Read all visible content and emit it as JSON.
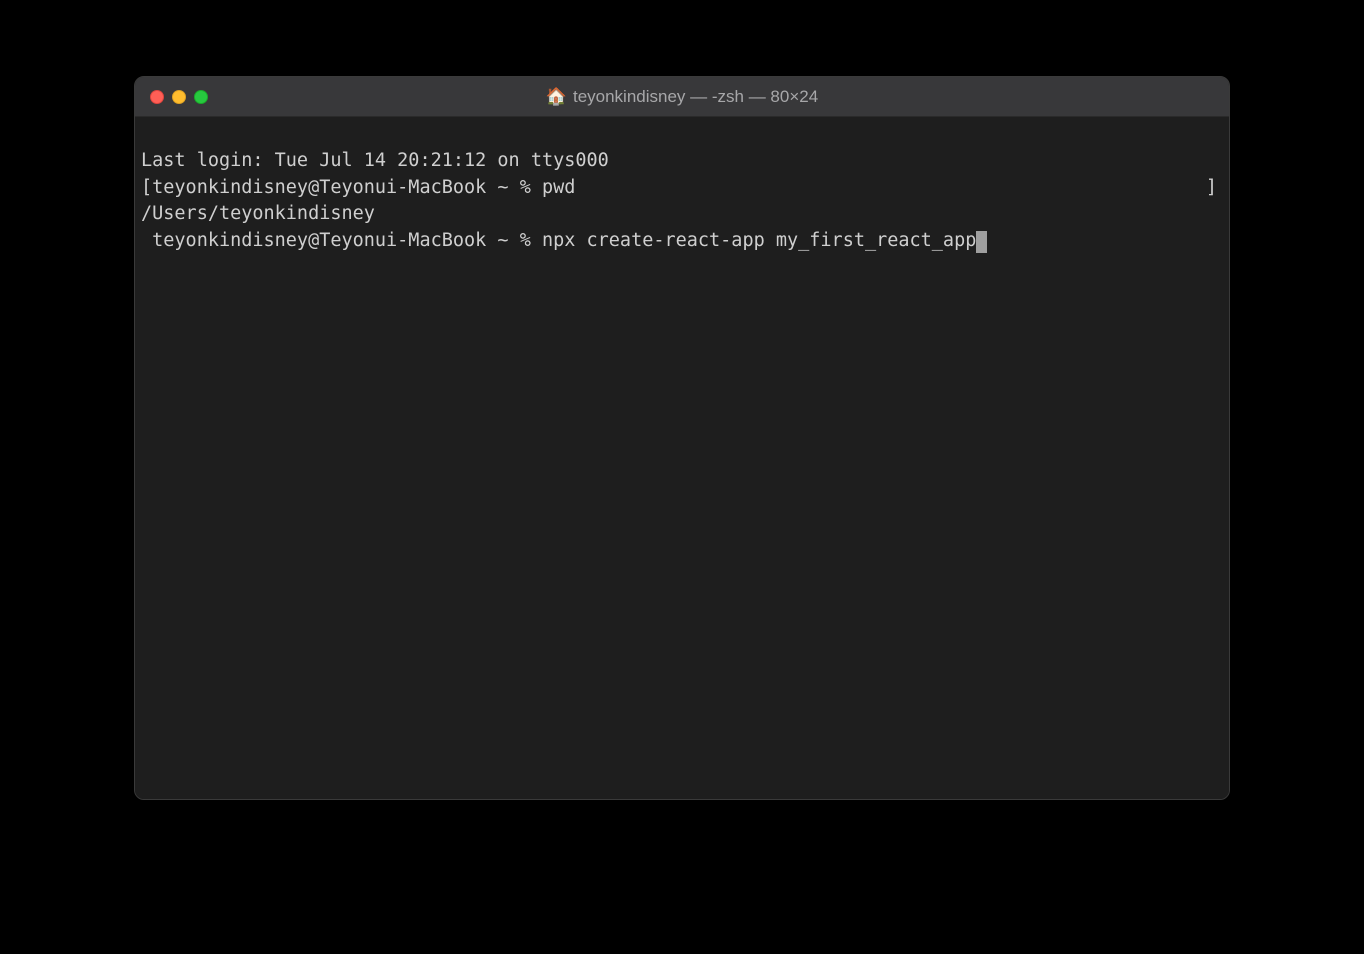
{
  "window": {
    "title": "teyonkindisney — -zsh — 80×24",
    "home_icon": "🏠"
  },
  "terminal": {
    "lines": [
      "Last login: Tue Jul 14 20:21:12 on ttys000",
      "[teyonkindisney@Teyonui-MacBook ~ % pwd",
      "/Users/teyonkindisney",
      " teyonkindisney@Teyonui-MacBook ~ % npx create-react-app my_first_react_app"
    ],
    "prompt_closing_bracket": "]"
  }
}
